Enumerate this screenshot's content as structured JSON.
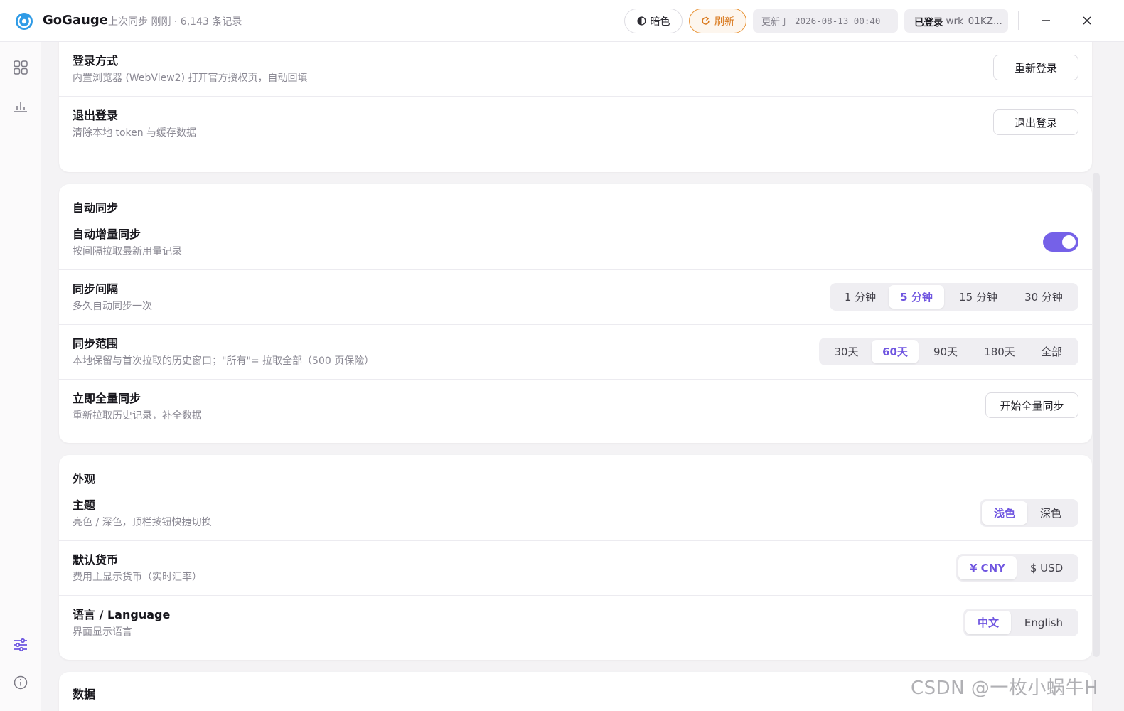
{
  "app": {
    "name": "GoGauge",
    "sync_status": "上次同步 刚刚 · 6,143 条记录"
  },
  "titlebar": {
    "theme_toggle_label": "暗色",
    "refresh_label": "刷新",
    "updated_label": "更新于",
    "updated_time": "2026-08-13 00:40",
    "login_label": "已登录",
    "login_account": "wrk_01KZ...",
    "minimize_icon": "minimize-icon",
    "close_icon": "close-icon"
  },
  "sidebar": {
    "items": [
      {
        "icon": "grid-icon",
        "active": false
      },
      {
        "icon": "bar-chart-icon",
        "active": false
      },
      {
        "icon": "sliders-icon",
        "active": true
      },
      {
        "icon": "info-icon",
        "active": false
      }
    ]
  },
  "account_card": {
    "rows": [
      {
        "title": "登录方式",
        "desc": "内置浏览器 (WebView2) 打开官方授权页，自动回填",
        "button": "重新登录"
      },
      {
        "title": "退出登录",
        "desc": "清除本地 token 与缓存数据",
        "button": "退出登录"
      }
    ]
  },
  "sync_card": {
    "title": "自动同步",
    "auto": {
      "title": "自动增量同步",
      "desc": "按间隔拉取最新用量记录",
      "enabled": true
    },
    "interval": {
      "title": "同步间隔",
      "desc": "多久自动同步一次",
      "options": [
        "1 分钟",
        "5 分钟",
        "15 分钟",
        "30 分钟"
      ],
      "selected": "5 分钟"
    },
    "range": {
      "title": "同步范围",
      "desc": "本地保留与首次拉取的历史窗口；\"所有\"= 拉取全部（500 页保险）",
      "options": [
        "30天",
        "60天",
        "90天",
        "180天",
        "全部"
      ],
      "selected": "60天"
    },
    "full": {
      "title": "立即全量同步",
      "desc": "重新拉取历史记录，补全数据",
      "button": "开始全量同步"
    }
  },
  "appearance_card": {
    "title": "外观",
    "theme": {
      "title": "主题",
      "desc": "亮色 / 深色，顶栏按钮快捷切换",
      "options": [
        "浅色",
        "深色"
      ],
      "selected": "浅色"
    },
    "currency": {
      "title": "默认货币",
      "desc": "费用主显示货币（实时汇率）",
      "options": [
        "¥ CNY",
        "$ USD"
      ],
      "selected": "¥ CNY"
    },
    "language": {
      "title": "语言 / Language",
      "desc": "界面显示语言",
      "options": [
        "中文",
        "English"
      ],
      "selected": "中文"
    }
  },
  "data_card": {
    "title": "数据"
  },
  "watermark": "CSDN @一枚小蜗牛H",
  "colors": {
    "accent": "#7561e8",
    "refresh": "#e9953a"
  }
}
